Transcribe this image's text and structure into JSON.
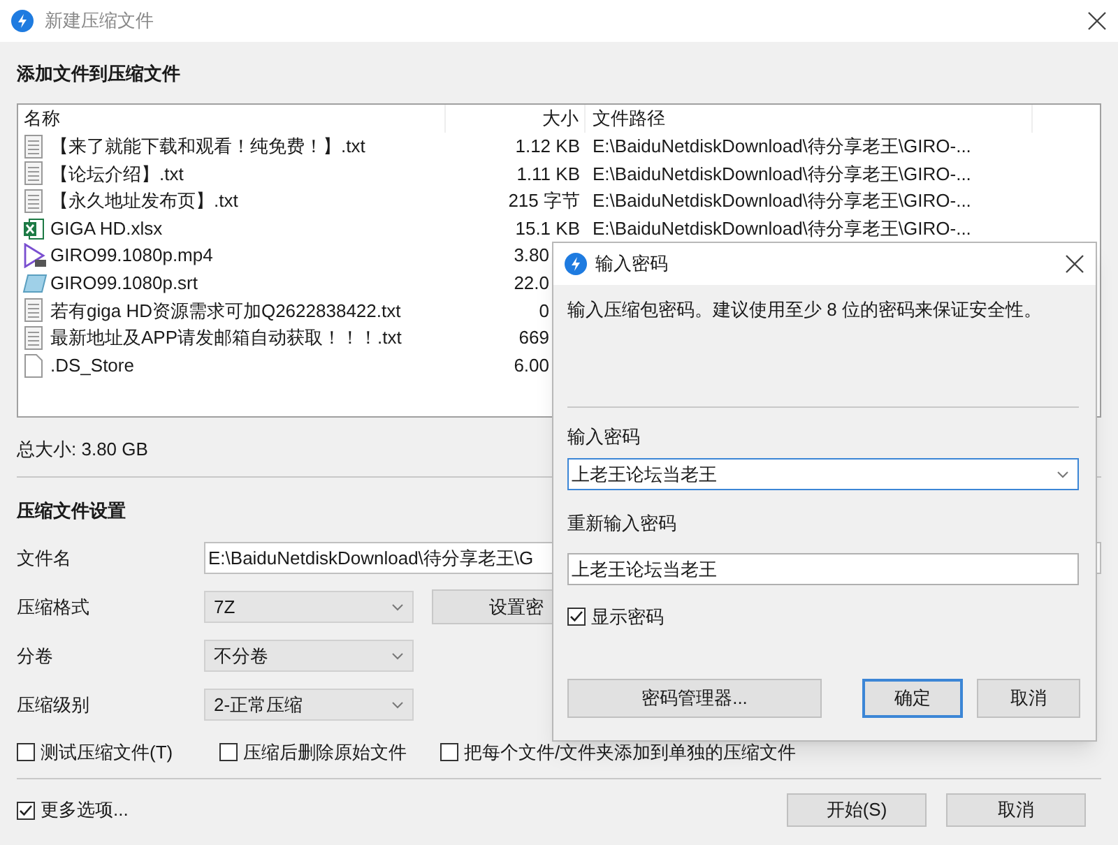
{
  "window": {
    "title": "新建压缩文件"
  },
  "files_section": {
    "heading": "添加文件到压缩文件",
    "columns": [
      "名称",
      "大小",
      "文件路径"
    ],
    "files": [
      {
        "kind": "text",
        "name": "【来了就能下载和观看！纯免费！】.txt",
        "size": "1.12 KB",
        "path": "E:\\BaiduNetdiskDownload\\待分享老王\\GIRO-..."
      },
      {
        "kind": "text",
        "name": "【论坛介绍】.txt",
        "size": "1.11 KB",
        "path": "E:\\BaiduNetdiskDownload\\待分享老王\\GIRO-..."
      },
      {
        "kind": "text",
        "name": "【永久地址发布页】.txt",
        "size": "215 字节",
        "path": "E:\\BaiduNetdiskDownload\\待分享老王\\GIRO-..."
      },
      {
        "kind": "spreadsheet",
        "name": "GIGA HD.xlsx",
        "size": "15.1 KB",
        "path": "E:\\BaiduNetdiskDownload\\待分享老王\\GIRO-..."
      },
      {
        "kind": "video",
        "name": "GIRO99.1080p.mp4",
        "size": "3.80"
      },
      {
        "kind": "subtitle",
        "name": "GIRO99.1080p.srt",
        "size": "22.0"
      },
      {
        "kind": "text",
        "name": "若有giga HD资源需求可加Q2622838422.txt",
        "size": "0"
      },
      {
        "kind": "text",
        "name": "最新地址及APP请发邮箱自动获取！！！.txt",
        "size": "669"
      },
      {
        "kind": "blank",
        "name": ".DS_Store",
        "size": "6.00"
      }
    ],
    "total": "总大小: 3.80 GB"
  },
  "settings": {
    "heading": "压缩文件设置",
    "filename": {
      "label": "文件名",
      "value": "E:\\BaiduNetdiskDownload\\待分享老王\\G"
    },
    "format": {
      "label": "压缩格式",
      "value": "7Z"
    },
    "set_password_button": "设置密",
    "volume": {
      "label": "分卷",
      "value": "不分卷"
    },
    "compression_level": {
      "label": "压缩级别",
      "value": "2-正常压缩"
    },
    "options": [
      {
        "label": "测试压缩文件(T)",
        "checked": false
      },
      {
        "label": "压缩后删除原始文件",
        "checked": false
      },
      {
        "label": "把每个文件/文件夹添加到单独的压缩文件",
        "checked": false
      }
    ]
  },
  "more_options": {
    "label": "更多选项...",
    "checked": true
  },
  "buttons": [
    "开始(S)",
    "取消"
  ],
  "password_dialog": {
    "title": "输入密码",
    "description": "输入压缩包密码。建议使用至少 8 位的密码来保证安全性。",
    "password_label": "输入密码",
    "password_value": "上老王论坛当老王",
    "confirm_label": "重新输入密码",
    "confirm_value": "上老王论坛当老王",
    "show_password": {
      "label": "显示密码",
      "checked": true
    },
    "buttons": [
      {
        "label": "密码管理器...",
        "default": false
      },
      {
        "label": "确定",
        "default": true
      },
      {
        "label": "取消",
        "default": false
      }
    ]
  }
}
